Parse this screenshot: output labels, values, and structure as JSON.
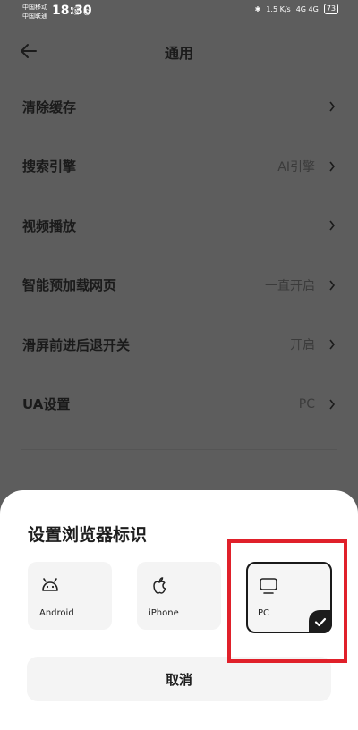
{
  "status_bar": {
    "carrier_1": "中国移动",
    "carrier_2": "中国联通",
    "time": "18:30",
    "speed": "1.5 K/s",
    "network": "4G 4G",
    "battery": "73"
  },
  "header": {
    "title": "通用"
  },
  "settings": {
    "items": [
      {
        "label": "清除缓存",
        "value": ""
      },
      {
        "label": "搜索引擎",
        "value": "AI引擎"
      },
      {
        "label": "视频播放",
        "value": ""
      },
      {
        "label": "智能预加载网页",
        "value": "一直开启"
      },
      {
        "label": "滑屏前进后退开关",
        "value": "开启"
      },
      {
        "label": "UA设置",
        "value": "PC"
      }
    ]
  },
  "sheet": {
    "title": "设置浏览器标识",
    "options": [
      {
        "label": "Android",
        "icon": "android-icon"
      },
      {
        "label": "iPhone",
        "icon": "apple-icon"
      },
      {
        "label": "PC",
        "icon": "monitor-icon",
        "selected": true
      }
    ],
    "cancel_label": "取消"
  },
  "colors": {
    "overlay": "#5d5d5d",
    "sheet": "#ffffff",
    "highlight": "#e0202a"
  }
}
